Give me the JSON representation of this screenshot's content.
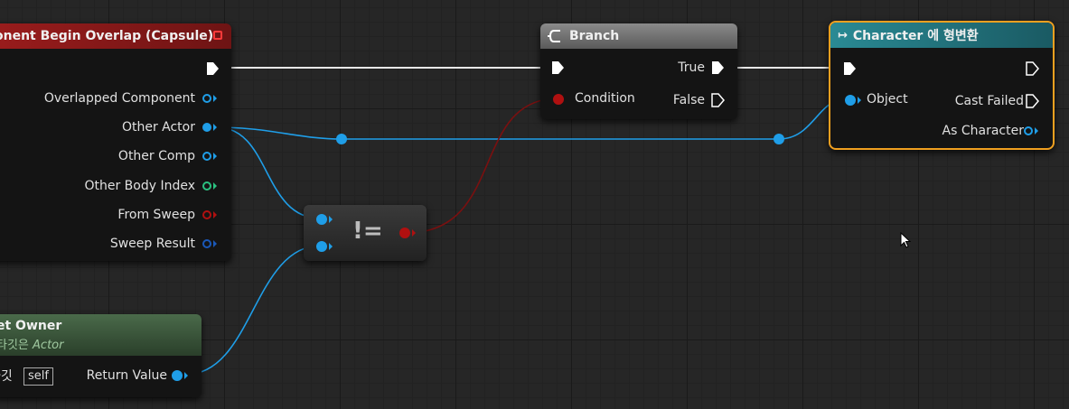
{
  "event_node": {
    "title": "onent Begin Overlap (Capsule)",
    "pins": [
      "Overlapped Component",
      "Other Actor",
      "Other Comp",
      "Other Body Index",
      "From Sweep",
      "Sweep Result"
    ]
  },
  "branch_node": {
    "title": "Branch",
    "condition_label": "Condition",
    "true_label": "True",
    "false_label": "False"
  },
  "cast_node": {
    "title": "Character 에 형변환",
    "object_label": "Object",
    "cast_failed_label": "Cast Failed",
    "as_character_label": "As Character"
  },
  "notequal_node": {
    "symbol": "!="
  },
  "getowner_node": {
    "title": "et Owner",
    "subtitle_prefix": "타깃은",
    "subtitle_type": "Actor",
    "target_label": "타깃",
    "self_label": "self",
    "return_label": "Return Value"
  },
  "colors": {
    "object_pin": "#1f9ee8",
    "bool_pin": "#b01010",
    "int_pin": "#2bc180",
    "struct_pin": "#1a58b8",
    "cast_border": "#f0a020",
    "cast_header": "#2a7f8a",
    "event_header": "#9a1c1c"
  }
}
